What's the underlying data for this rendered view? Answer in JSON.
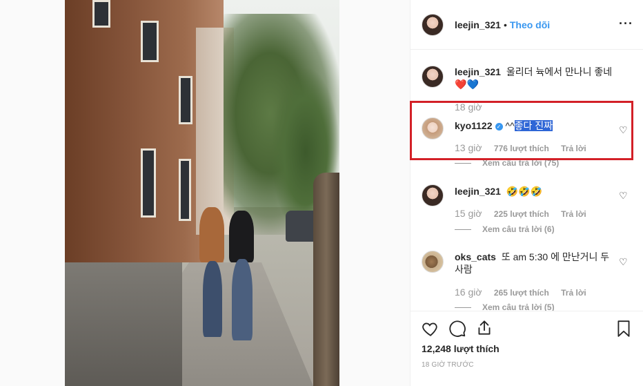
{
  "post": {
    "author": "leejin_321",
    "separator": "•",
    "follow_label": "Theo dõi",
    "more_label": "···",
    "likes": "12,248 lượt thích",
    "time_ago": "18 GIỜ TRƯỚC"
  },
  "comments": [
    {
      "user": "leejin_321",
      "text": "울리더 뉵에서 만나니 좋네",
      "hearts": [
        "❤️",
        "💙"
      ],
      "time": "18 giờ"
    },
    {
      "user": "kyo1122",
      "verified": true,
      "text_prefix": "^^",
      "text_selected": "좋다 진짜",
      "time": "13 giờ",
      "likes": "776 lượt thích",
      "reply_label": "Trả lời",
      "view_replies": "Xem câu trả lời (75)"
    },
    {
      "user": "leejin_321",
      "text": "🤣🤣🤣",
      "time": "15 giờ",
      "likes": "225 lượt thích",
      "reply_label": "Trả lời",
      "view_replies": "Xem câu trả lời (6)"
    },
    {
      "user": "oks_cats",
      "text": "또 am 5:30 에 만난거니 두사람",
      "time": "16 giờ",
      "likes": "265 lượt thích",
      "reply_label": "Trả lời",
      "view_replies": "Xem câu trả lời (5)"
    }
  ],
  "icons": {
    "like": "heart-icon",
    "comment": "comment-icon",
    "share": "share-icon",
    "save": "bookmark-icon",
    "comment_like": "small-heart-icon"
  },
  "colors": {
    "link": "#3897f0",
    "highlight_border": "#d32027",
    "selection": "#2e66d6"
  }
}
